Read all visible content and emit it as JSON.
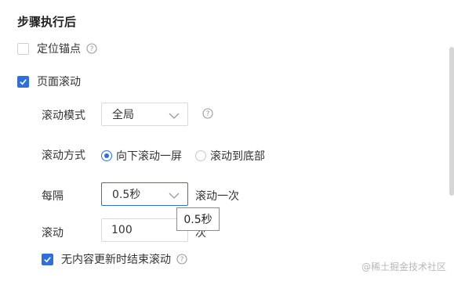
{
  "section_title": "步骤执行后",
  "anchor": {
    "label": "定位锚点",
    "checked": false
  },
  "page_scroll": {
    "label": "页面滚动",
    "checked": true
  },
  "scroll_mode": {
    "label": "滚动模式",
    "value": "全局"
  },
  "scroll_method": {
    "label": "滚动方式",
    "options": [
      "向下滚动一屏",
      "滚动到底部"
    ],
    "selected": 0
  },
  "interval": {
    "label": "每隔",
    "value": "0.5秒",
    "suffix": "滚动一次",
    "tooltip": "0.5秒"
  },
  "scroll_count": {
    "label": "滚动",
    "value": "100",
    "suffix": "次"
  },
  "stop_on_no_update": {
    "label": "无内容更新时结束滚动",
    "checked": true
  },
  "watermark": "@稀土掘金技术社区",
  "colors": {
    "accent": "#2f6fdb"
  }
}
